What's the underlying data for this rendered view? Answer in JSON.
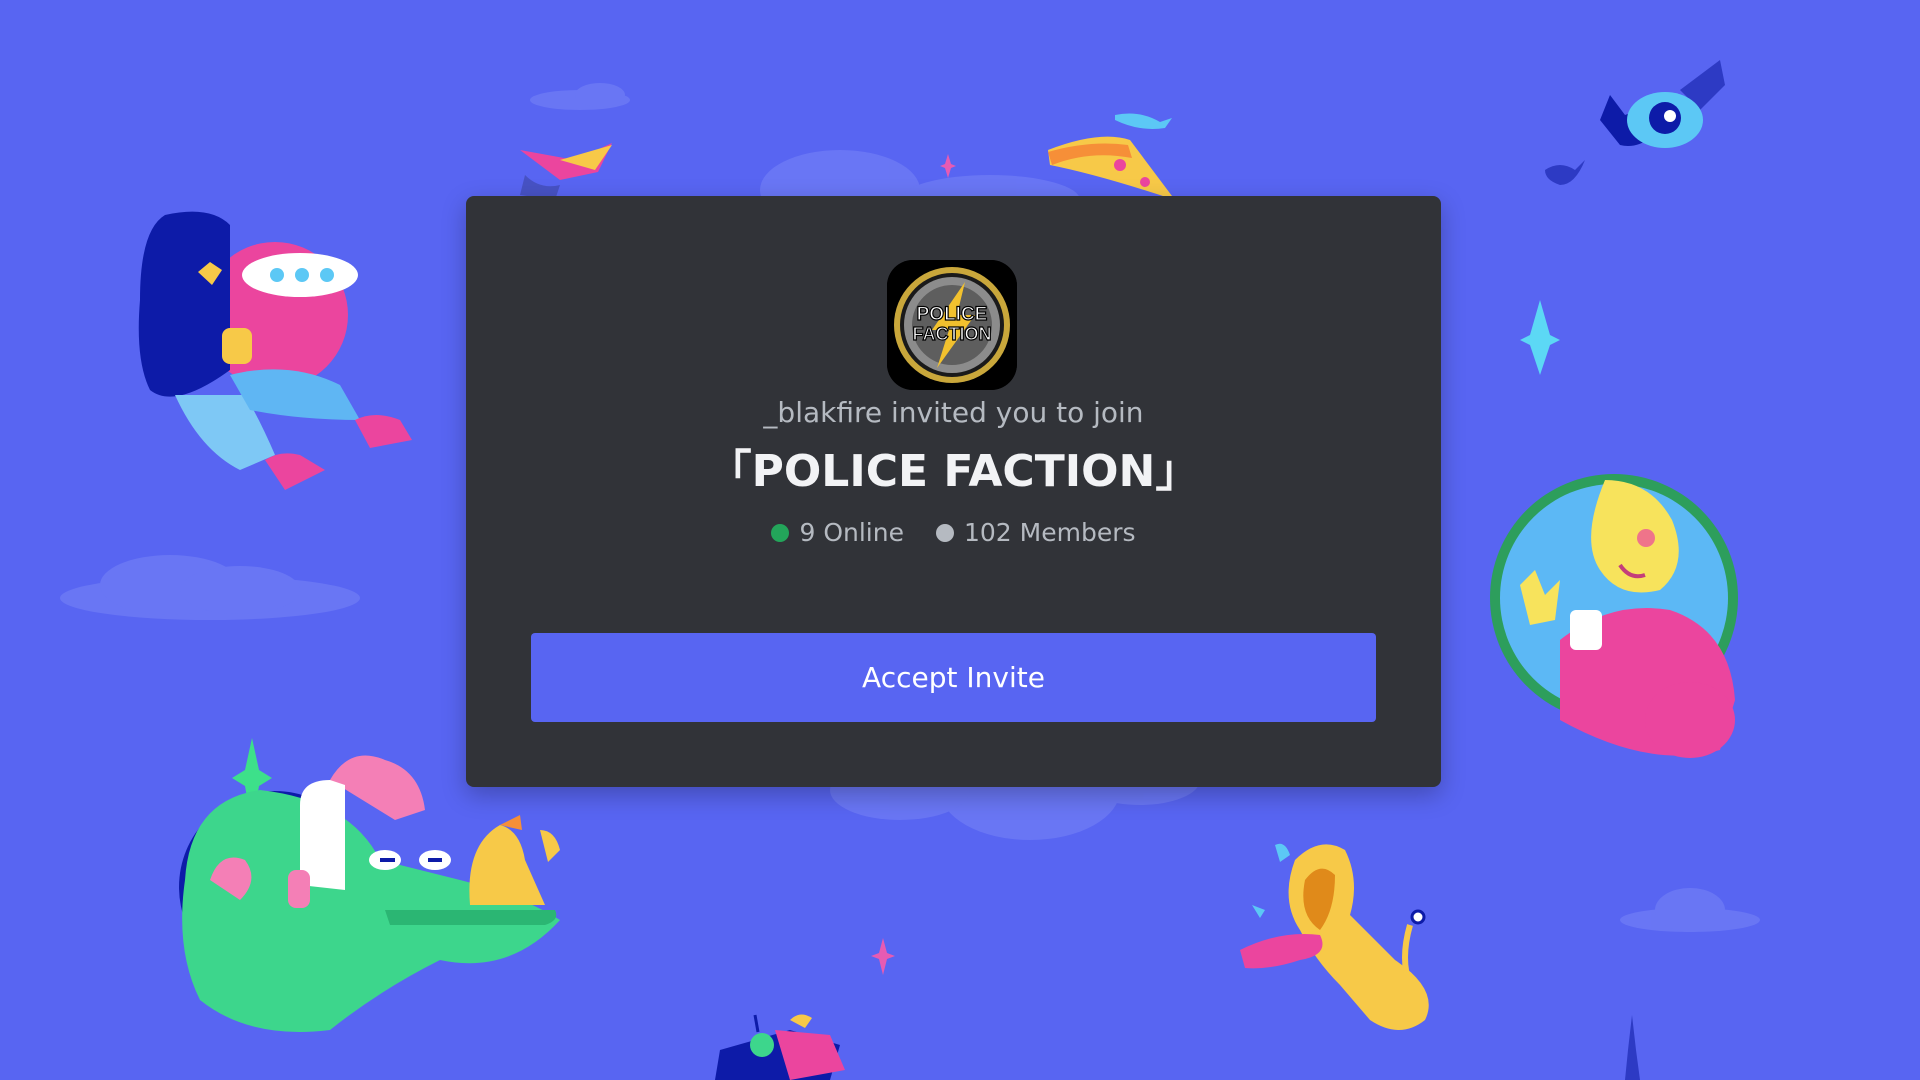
{
  "invite": {
    "inviter_text": "_blakfire invited you to join",
    "server_name": "「POLICE FACTION」",
    "server_icon_text": [
      "POLICE",
      "FACTION"
    ],
    "online_label": "9 Online",
    "members_label": "102 Members",
    "accept_label": "Accept Invite"
  },
  "colors": {
    "background": "#5865F2",
    "modal": "#313338",
    "button": "#5865F2",
    "online": "#23A55A",
    "members": "#B5BAC1"
  },
  "icons": {
    "online_status": "online-dot-icon",
    "member_status": "member-dot-icon",
    "server": "police-faction-server-icon"
  }
}
